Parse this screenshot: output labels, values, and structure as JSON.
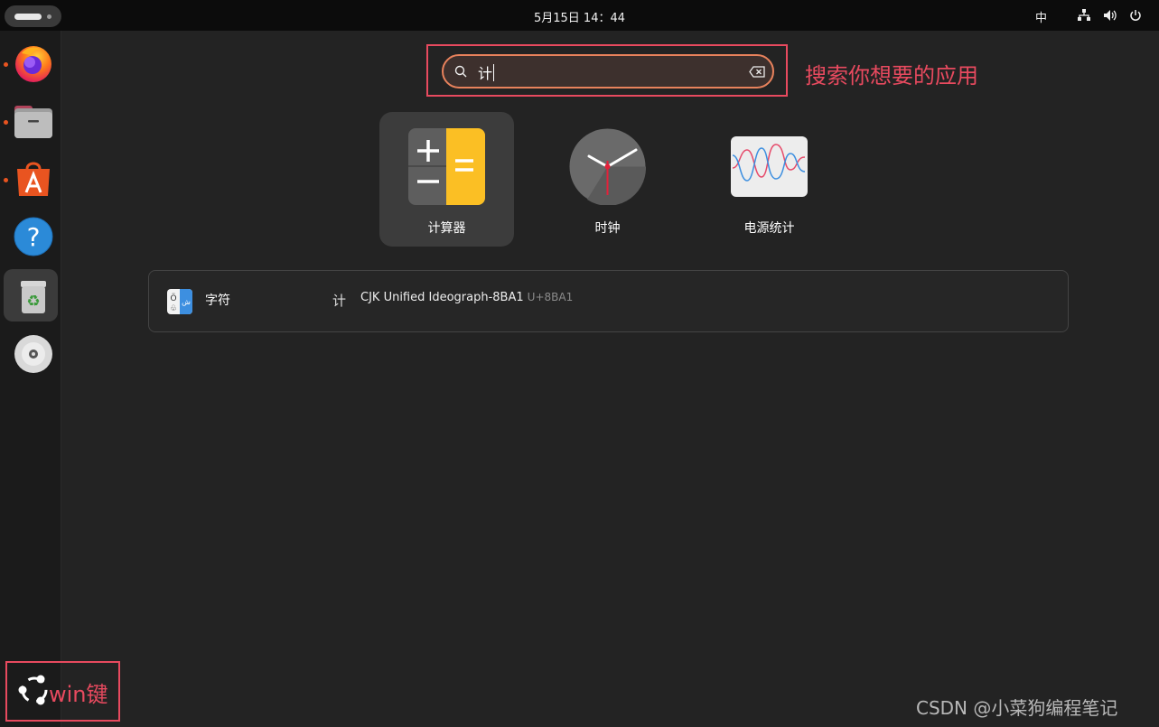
{
  "topbar": {
    "clock": "5月15日  14：44",
    "input_method": "中",
    "tray_icons": [
      "network-icon",
      "volume-icon",
      "power-icon"
    ]
  },
  "dock": {
    "items": [
      {
        "name": "firefox",
        "running": true
      },
      {
        "name": "files",
        "running": true
      },
      {
        "name": "app-center",
        "running": true
      },
      {
        "name": "help",
        "running": false
      },
      {
        "name": "trash",
        "running": true,
        "active": true
      },
      {
        "name": "disc",
        "running": false
      }
    ]
  },
  "search": {
    "query": "计",
    "annotation": "搜索你想要的应用"
  },
  "apps": [
    {
      "label": "计算器",
      "icon": "calculator-icon",
      "selected": true
    },
    {
      "label": "时钟",
      "icon": "clock-icon",
      "selected": false
    },
    {
      "label": "电源统计",
      "icon": "power-statistics-icon",
      "selected": false
    }
  ],
  "result": {
    "app_name": "字符",
    "character": "计",
    "description": "CJK Unified Ideograph-8BA1",
    "codepoint": "U+8BA1"
  },
  "win_key_label": "win键",
  "watermark": "CSDN @小菜狗编程笔记",
  "colors": {
    "highlight": "#e84a5f",
    "accent": "#e95420",
    "search_border": "#e8825c"
  }
}
